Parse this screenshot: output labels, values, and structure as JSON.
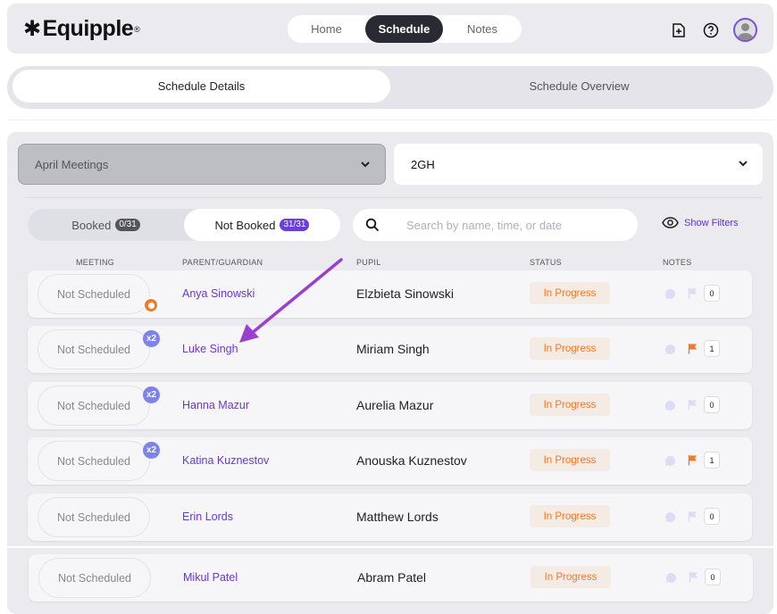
{
  "brand": {
    "name": "Equipple",
    "mark": "®"
  },
  "nav": {
    "tabs": [
      {
        "label": "Home"
      },
      {
        "label": "Schedule"
      },
      {
        "label": "Notes"
      }
    ],
    "active": "Schedule"
  },
  "subtabs": [
    {
      "label": "Schedule Details"
    },
    {
      "label": "Schedule Overview"
    }
  ],
  "filters": {
    "meeting_select": {
      "value": "April Meetings"
    },
    "class_select": {
      "value": "2GH"
    }
  },
  "booking_toggle": {
    "booked": {
      "label": "Booked",
      "count": "0/31"
    },
    "not_booked": {
      "label": "Not Booked",
      "count": "31/31"
    }
  },
  "search": {
    "placeholder": "Search by name, time, or date"
  },
  "show_filters": {
    "label": "Show Filters"
  },
  "columns": {
    "meeting": "MEETING",
    "parent": "PARENT/GUARDIAN",
    "pupil": "PUPIL",
    "status": "STATUS",
    "notes": "NOTES"
  },
  "rows": [
    {
      "meeting": "Not Scheduled",
      "badge": "chat",
      "parent": "Anya Sinowski",
      "pupil": "Elzbieta Sinowski",
      "status": "In Progress",
      "flagged": false,
      "notes_count": "0"
    },
    {
      "meeting": "Not Scheduled",
      "badge": "x2",
      "parent": "Luke Singh",
      "pupil": "Miriam Singh",
      "status": "In Progress",
      "flagged": true,
      "notes_count": "1"
    },
    {
      "meeting": "Not Scheduled",
      "badge": "x2",
      "parent": "Hanna Mazur",
      "pupil": "Aurelia Mazur",
      "status": "In Progress",
      "flagged": false,
      "notes_count": "0"
    },
    {
      "meeting": "Not Scheduled",
      "badge": "x2",
      "parent": "Katina Kuznestov",
      "pupil": "Anouska Kuznestov",
      "status": "In Progress",
      "flagged": true,
      "notes_count": "1"
    },
    {
      "meeting": "Not Scheduled",
      "badge": "",
      "parent": "Erin Lords",
      "pupil": "Matthew Lords",
      "status": "In Progress",
      "flagged": false,
      "notes_count": "0"
    },
    {
      "meeting": "Not Scheduled",
      "badge": "",
      "parent": "Mikul Patel",
      "pupil": "Abram Patel",
      "status": "In Progress",
      "flagged": false,
      "notes_count": "0"
    }
  ],
  "x2_label": "x2",
  "colors": {
    "accent": "#6a38d0",
    "status": "#f07a2a",
    "flag_active": "#f07a2a",
    "flag_inactive": "#dcdcf4",
    "annotation_arrow": "#9a3fd0"
  }
}
